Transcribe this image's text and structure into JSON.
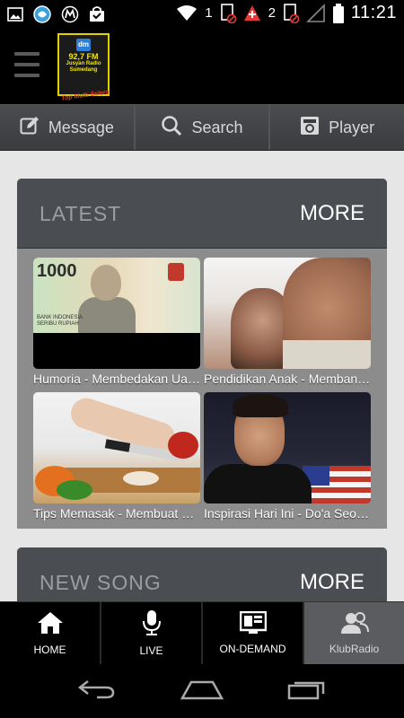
{
  "status_bar": {
    "sim1_label": "1",
    "sim2_label": "2",
    "time": "11:21",
    "icons": [
      "image-icon",
      "browser-icon",
      "motorola-icon",
      "bag-icon",
      "wifi-icon",
      "sim1-blocked-icon",
      "swiss-icon",
      "sim2-blocked-icon",
      "no-signal-icon",
      "battery-icon"
    ]
  },
  "header": {
    "logo": {
      "badge": "dm",
      "frequency": "92,7 FM",
      "name_line1": "Jusyan Radio",
      "name_line2": "Sumedang",
      "tagline": "Top Multi Selera"
    }
  },
  "toolbar": {
    "items": [
      {
        "label": "Message",
        "icon": "compose-icon"
      },
      {
        "label": "Search",
        "icon": "search-icon"
      },
      {
        "label": "Player",
        "icon": "radio-player-icon"
      }
    ]
  },
  "sections": {
    "latest": {
      "title": "LATEST",
      "more_label": "MORE",
      "items": [
        {
          "caption": "Humoria - Membedakan Uang Asli dan Palsu"
        },
        {
          "caption": "Pendidikan Anak - Membangun Karakter"
        },
        {
          "caption": "Tips Memasak - Membuat Kue Lezat"
        },
        {
          "caption": "Inspirasi Hari Ini - Do'a Seorang Ibu"
        }
      ]
    },
    "new_song": {
      "title": "NEW SONG",
      "more_label": "MORE"
    }
  },
  "bottom_nav": {
    "items": [
      {
        "label": "HOME",
        "icon": "home-icon",
        "active": false
      },
      {
        "label": "LIVE",
        "icon": "microphone-icon",
        "active": false
      },
      {
        "label": "ON-DEMAND",
        "icon": "on-demand-icon",
        "active": false
      },
      {
        "label": "KlubRadio",
        "icon": "users-icon",
        "active": true
      }
    ]
  },
  "system_nav": {
    "icons": [
      "back-icon",
      "home-outline-icon",
      "recent-apps-icon"
    ]
  },
  "colors": {
    "toolbar_bg": "#3b3d40",
    "card_bg": "#474a4e",
    "content_bg": "#e6e6e6",
    "active_nav_bg": "#5a5c5f",
    "logo_yellow": "#f2e800"
  }
}
